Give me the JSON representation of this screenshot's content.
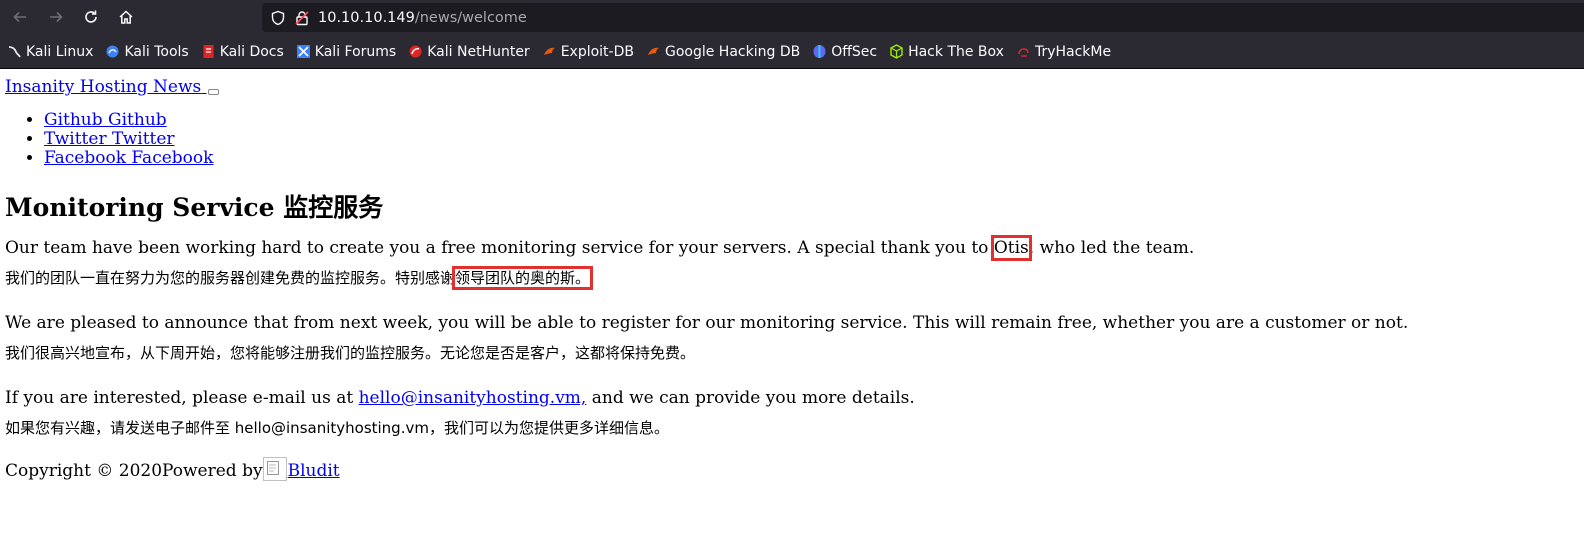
{
  "browser": {
    "url_host": "10.10.10.149",
    "url_path": "/news/welcome",
    "bookmarks": [
      {
        "label": "Kali Linux",
        "color": "#e8e8e8"
      },
      {
        "label": "Kali Tools",
        "color": "#3b82f6"
      },
      {
        "label": "Kali Docs",
        "color": "#dc2626"
      },
      {
        "label": "Kali Forums",
        "color": "#3b82f6"
      },
      {
        "label": "Kali NetHunter",
        "color": "#dc2626"
      },
      {
        "label": "Exploit-DB",
        "color": "#ea580c"
      },
      {
        "label": "Google Hacking DB",
        "color": "#ea580c"
      },
      {
        "label": "OffSec",
        "color": "#6366f1"
      },
      {
        "label": "Hack The Box",
        "color": "#9fef00"
      },
      {
        "label": "TryHackMe",
        "color": "#dc2626"
      }
    ]
  },
  "site": {
    "brand": "Insanity Hosting News",
    "social": [
      "Github Github",
      "Twitter Twitter",
      "Facebook Facebook"
    ]
  },
  "article": {
    "title": "Monitoring Service 监控服务",
    "p1_en_before": "Our team have been working hard to create you a free monitoring service for your servers. A special thank you to ",
    "p1_en_highlight": "Otis",
    "p1_en_after": ", who led the team.",
    "p1_cn_before": "我们的团队一直在努力为您的服务器创建免费的监控服务。特别感谢",
    "p1_cn_highlight": "领导团队的奥的斯。",
    "p2_en": "We are pleased to announce that from next week, you will be able to register for our monitoring service. This will remain free, whether you are a customer or not.",
    "p2_cn": "我们很高兴地宣布，从下周开始，您将能够注册我们的监控服务。无论您是否是客户，这都将保持免费。",
    "p3_en_before": "If you are interested, please e-mail us at ",
    "p3_email": "hello@insanityhosting.vm,",
    "p3_en_after": " and we can provide you more details.",
    "p3_cn": "如果您有兴趣，请发送电子邮件至 hello@insanityhosting.vm，我们可以为您提供更多详细信息。"
  },
  "footer": {
    "copyright": "Copyright © 2020Powered by",
    "powered_link": "Bludit"
  },
  "colors": {
    "highlight_box": "#e03030",
    "link": "#0000ee",
    "chrome_bg": "#2b2a33"
  }
}
